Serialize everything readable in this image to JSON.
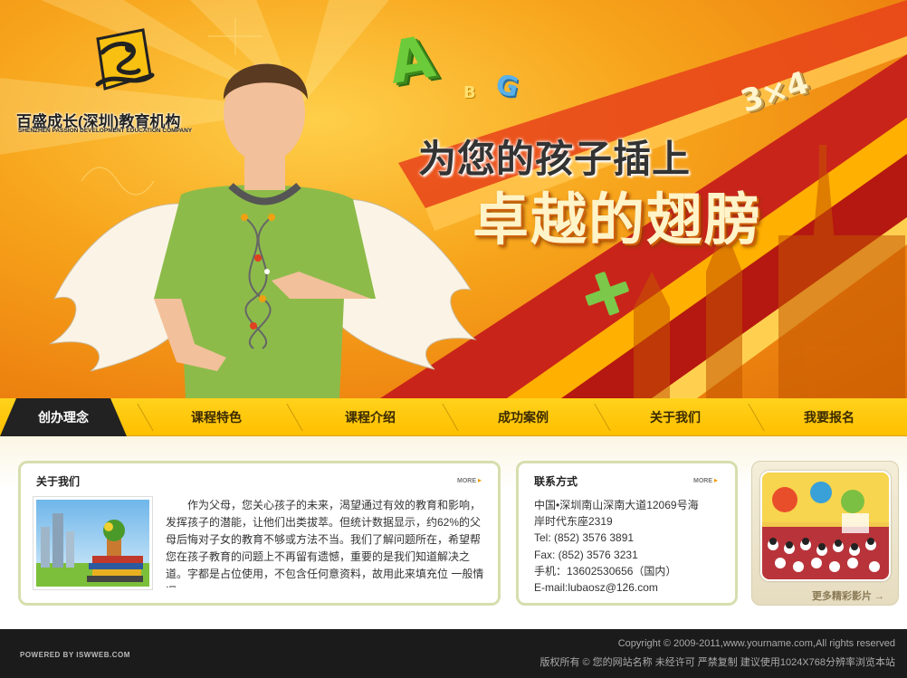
{
  "colors": {
    "nav_bg": "#ffc80a",
    "nav_active": "#222222",
    "accent_orange": "#f39800",
    "box_border": "#d7deae",
    "footer_bg": "#1b1b1b"
  },
  "banner": {
    "logo_cn": "百盛成长(深圳)教育机构",
    "logo_en": "SHENZHEN PASSION DEVELOPMENT EDUCATION COMPANY",
    "slogan_line1": "为您的孩子插上",
    "slogan_line2": "卓越的翅膀",
    "letters": [
      "A",
      "B",
      "G",
      "3×4"
    ]
  },
  "nav": {
    "items": [
      {
        "label": "创办理念",
        "active": true
      },
      {
        "label": "课程特色",
        "active": false
      },
      {
        "label": "课程介绍",
        "active": false
      },
      {
        "label": "成功案例",
        "active": false
      },
      {
        "label": "关于我们",
        "active": false
      },
      {
        "label": "我要报名",
        "active": false
      }
    ]
  },
  "about": {
    "title": "关于我们",
    "more": "MORE",
    "text": "作为父母，您关心孩子的未来，渴望通过有效的教育和影响，发挥孩子的潜能，让他们出类拔萃。但统计数据显示，约62%的父母后悔对子女的教育不够或方法不当。我们了解问题所在，希望帮您在孩子教育的问题上不再留有遗憾，重要的是我们知道解决之道。字都是占位使用，不包含任何意资料，故用此来填充位 一般情况"
  },
  "contact": {
    "title": "联系方式",
    "more": "MORE",
    "lines": [
      "中国•深圳南山深南大道12069号海",
      "岸时代东座2319",
      "Tel:  (852)  3576 3891",
      "Fax:  (852)  3576 3231",
      "手机：13602530656（国内）",
      "E-mail:lubaosz@126.com"
    ]
  },
  "video": {
    "more": "更多精彩影片 →"
  },
  "footer": {
    "powered": "POWERED BY ISWWEB.COM",
    "copyright": "Copyright © 2009-2011,www.yourname.com,All rights reserved",
    "notice": "版权所有 © 您的网站名称 未经许可 严禁复制 建议使用1024X768分辨率浏览本站"
  }
}
